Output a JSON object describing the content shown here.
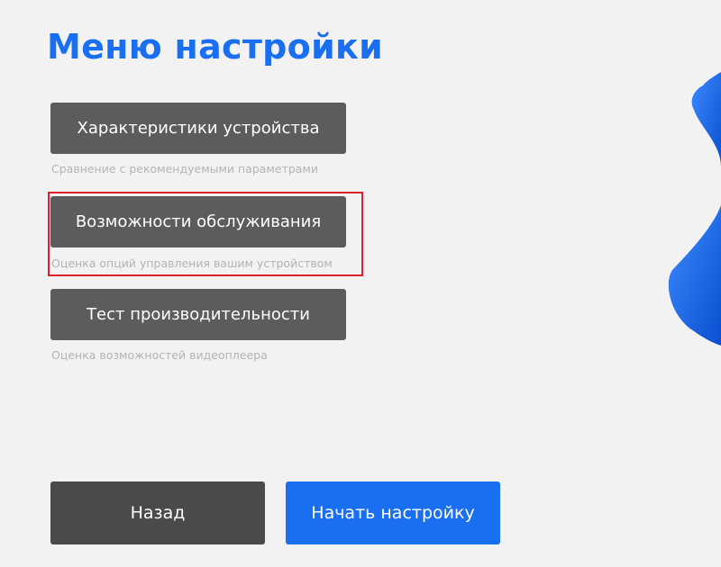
{
  "colors": {
    "accent": "#1a6ff0",
    "menu_button_bg": "#5c5c5c",
    "back_button_bg": "#4a4a4a",
    "start_button_bg": "#1a6ff0",
    "highlight": "#e0202a"
  },
  "title": "Меню настройки",
  "menu": [
    {
      "label": "Характеристики устройства",
      "description": "Сравнение с рекомендуемыми параметрами"
    },
    {
      "label": "Возможности обслуживания",
      "description": "Оценка опций управления вашим устройством"
    },
    {
      "label": "Тест производительности",
      "description": "Оценка возможностей видеоплеера"
    }
  ],
  "footer": {
    "back_label": "Назад",
    "start_label": "Начать настройку"
  },
  "decoration": {
    "icon": "blue-abstract-shape"
  }
}
